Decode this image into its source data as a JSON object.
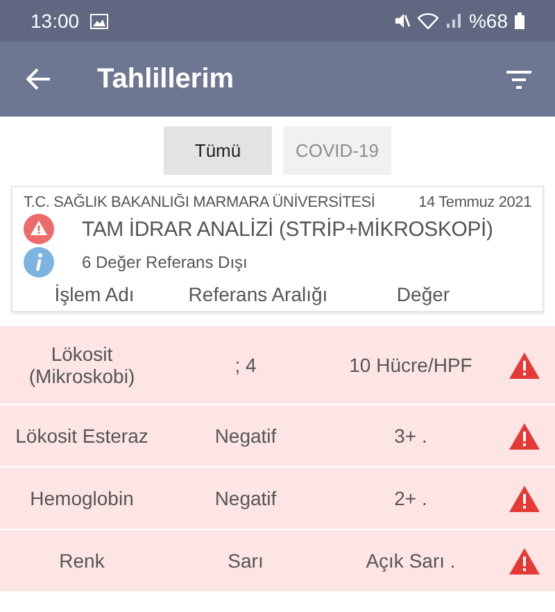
{
  "status_bar": {
    "time": "13:00",
    "battery": "%68"
  },
  "app_bar": {
    "title": "Tahlillerim"
  },
  "tabs": [
    {
      "label": "Tümü",
      "selected": true
    },
    {
      "label": "COVID-19",
      "selected": false
    }
  ],
  "card": {
    "institution": "T.C. SAĞLIK BAKANLIĞI MARMARA ÜNİVERSİTESİ",
    "date": "14 Temmuz 2021",
    "test_name": "TAM İDRAR ANALİZİ (STRİP+MİKROSKOPİ)",
    "summary": "6 Değer Referans Dışı",
    "columns": [
      "İşlem Adı",
      "Referans Aralığı",
      "Değer"
    ]
  },
  "rows": [
    {
      "name": "Lökosit (Mikroskobi)",
      "reference": "; 4",
      "value": "10 Hücre/HPF",
      "abnormal": true
    },
    {
      "name": "Lökosit Esteraz",
      "reference": "Negatif",
      "value": "3+ .",
      "abnormal": true
    },
    {
      "name": "Hemoglobin",
      "reference": "Negatif",
      "value": "2+ .",
      "abnormal": true
    },
    {
      "name": "Renk",
      "reference": "Sarı",
      "value": "Açık Sarı .",
      "abnormal": true
    }
  ]
}
